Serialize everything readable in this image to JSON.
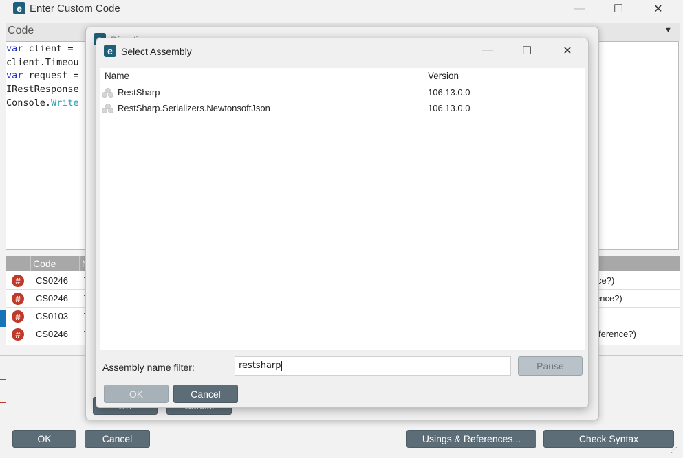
{
  "main_window": {
    "title": "Enter Custom Code",
    "code_header": "Code",
    "pin_glyph": "📌",
    "code_lines": [
      {
        "kw": "var",
        "rest": " client ="
      },
      {
        "kw": "",
        "rest": "client.Timeou"
      },
      {
        "kw": "var",
        "rest": " request ="
      },
      {
        "kw": "",
        "rest": "IRestResponse"
      },
      {
        "kw": "",
        "rest": "Console.",
        "method": "Write"
      }
    ],
    "errors_table": {
      "code_header": "Code",
      "col3_header_fragment": "N",
      "rows": [
        {
          "code": "CS0246",
          "prefix": "T",
          "tail": "ce?)"
        },
        {
          "code": "CS0246",
          "prefix": "T",
          "tail": "ence?)"
        },
        {
          "code": "CS0103",
          "prefix": "T",
          "tail": ""
        },
        {
          "code": "CS0246",
          "prefix": "T",
          "tail": "ference?)"
        }
      ],
      "error_icon_glyph": "#"
    },
    "buttons": {
      "ok": "OK",
      "cancel": "Cancel",
      "usings": "Usings & References...",
      "check_syntax": "Check Syntax"
    }
  },
  "middle_dialog": {
    "title_fragment": "Directive",
    "buttons": {
      "ok": "OK",
      "cancel": "Cancel"
    }
  },
  "select_assembly": {
    "title": "Select Assembly",
    "columns": {
      "name": "Name",
      "version": "Version"
    },
    "rows": [
      {
        "name": "RestSharp",
        "version": "106.13.0.0"
      },
      {
        "name": "RestSharp.Serializers.NewtonsoftJson",
        "version": "106.13.0.0"
      }
    ],
    "filter_label": "Assembly name filter:",
    "filter_value": "restsharp",
    "buttons": {
      "pause": "Pause",
      "ok": "OK",
      "cancel": "Cancel"
    }
  },
  "window_controls": {
    "minimize": "—",
    "maximize": "☐",
    "close": "✕"
  },
  "colors": {
    "brand": "#1f5f7a",
    "button_dark": "#5d6d78",
    "error_red": "#c0392b",
    "keyword_blue": "#1f32c7",
    "accent_blue": "#1673b8"
  }
}
